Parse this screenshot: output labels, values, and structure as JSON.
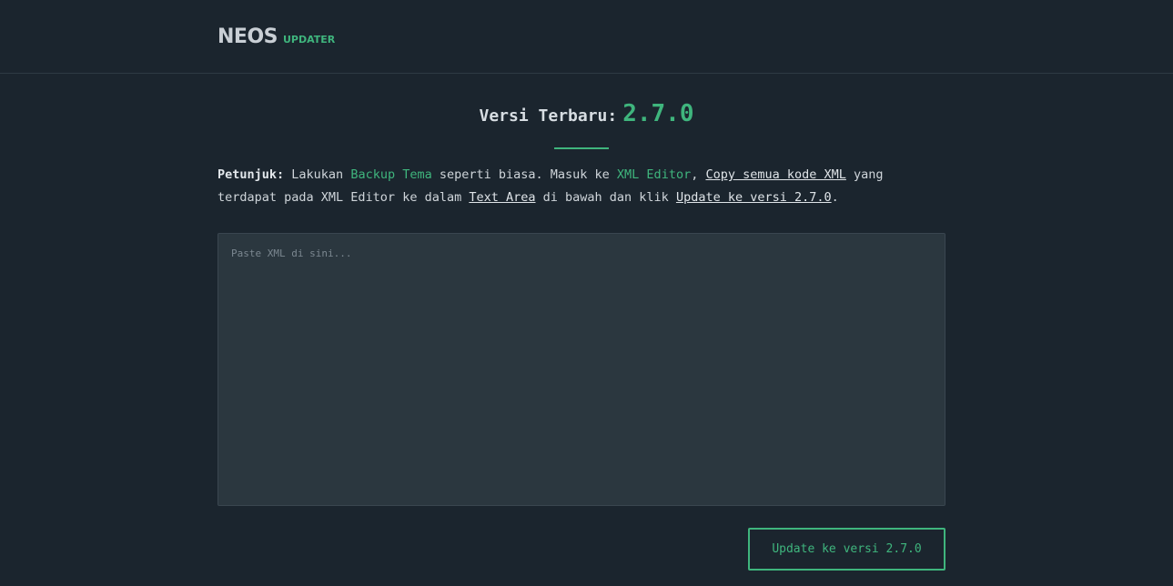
{
  "header": {
    "brand_main": "NEOS",
    "brand_sub": "UPDATER"
  },
  "version": {
    "label": "Versi Terbaru:",
    "value": "2.7.0"
  },
  "instructions": {
    "lead": "Petunjuk:",
    "t1": " Lakukan ",
    "backup": "Backup Tema",
    "t2": " seperti biasa. Masuk ke ",
    "xml_editor": "XML Editor",
    "t3": ", ",
    "copy_all": "Copy semua kode XML",
    "t4": " yang terdapat pada XML Editor ke dalam ",
    "text_area": "Text Area",
    "t5": " di bawah dan klik ",
    "update_link": "Update ke versi 2.7.0",
    "t6": "."
  },
  "xml_input": {
    "value": "",
    "placeholder": "Paste XML di sini..."
  },
  "update_button": {
    "label": "Update ke versi 2.7.0"
  },
  "colors": {
    "background": "#1b252e",
    "accent": "#3fb57d",
    "textarea_bg": "#2b373f"
  }
}
